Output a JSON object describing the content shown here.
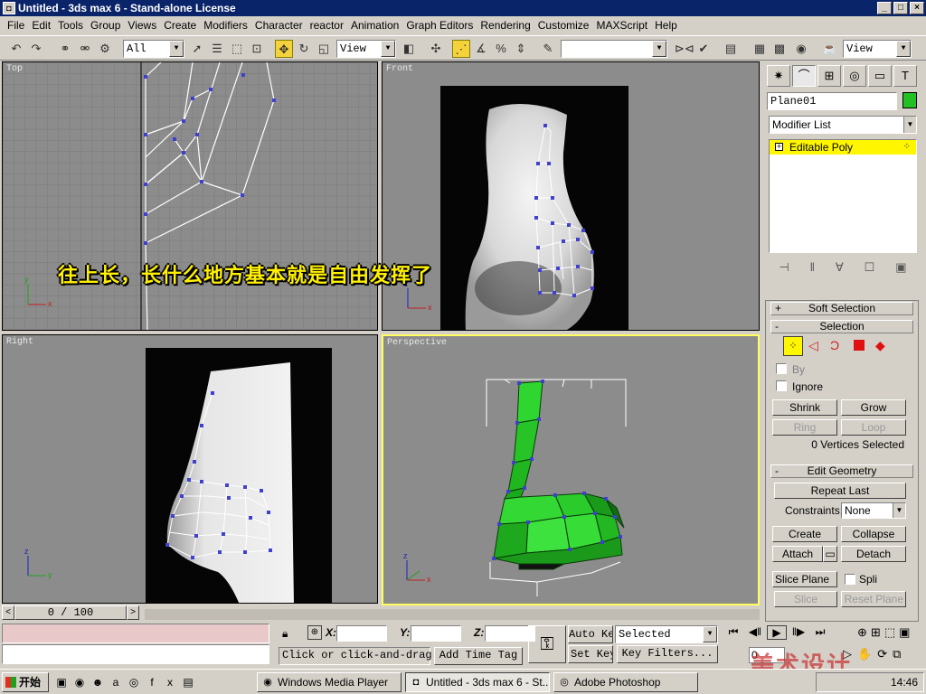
{
  "window": {
    "title": "Untitled - 3ds max 6 - Stand-alone License",
    "min": "_",
    "max": "□",
    "close": "×"
  },
  "menu": [
    "File",
    "Edit",
    "Tools",
    "Group",
    "Views",
    "Create",
    "Modifiers",
    "Character",
    "reactor",
    "Animation",
    "Graph Editors",
    "Rendering",
    "Customize",
    "MAXScript",
    "Help"
  ],
  "toolbar": {
    "selection_filter": "All",
    "ref_coord": "View",
    "named_selection": "",
    "render_view": "View"
  },
  "viewports": {
    "top": "Top",
    "front": "Front",
    "right": "Right",
    "perspective": "Perspective"
  },
  "overlay_caption": "往上长，长什么地方基本就是自由发挥了",
  "command_panel": {
    "object_name": "Plane01",
    "modifier_list": "Modifier List",
    "stack_item": "Editable Poly",
    "soft_selection": "Soft Selection",
    "selection": "Selection",
    "by_vertex": "By",
    "ignore_backfacing": "Ignore",
    "shrink": "Shrink",
    "grow": "Grow",
    "ring": "Ring",
    "loop": "Loop",
    "selected_count": "0 Vertices Selected",
    "edit_geometry": "Edit Geometry",
    "repeat_last": "Repeat Last",
    "constraints_label": "Constraints:",
    "constraints_value": "None",
    "create": "Create",
    "collapse": "Collapse",
    "attach": "Attach",
    "detach": "Detach",
    "slice_plane": "Slice Plane",
    "split": "Spli",
    "slice": "Slice",
    "reset_plane": "Reset Plane"
  },
  "status": {
    "frame": "0 / 100",
    "x_label": "X:",
    "y_label": "Y:",
    "z_label": "Z:",
    "prompt": "Click or click-and-drag",
    "add_time_tag": "Add Time Tag",
    "auto_key": "Auto Key",
    "set_key": "Set Key",
    "key_mode": "Selected",
    "key_filters": "Key Filters...",
    "frame_field": "0"
  },
  "taskbar": {
    "start": "开始",
    "tasks": [
      "Windows Media Player",
      "Untitled - 3ds max 6 - St...",
      "Adobe Photoshop"
    ],
    "clock": "14:46"
  },
  "watermark": "美术设计",
  "colors": {
    "title_bar": "#0a246a",
    "active_viewport": "#ffff60",
    "editable_poly": "#fff600",
    "mesh_green": "#22c022"
  }
}
